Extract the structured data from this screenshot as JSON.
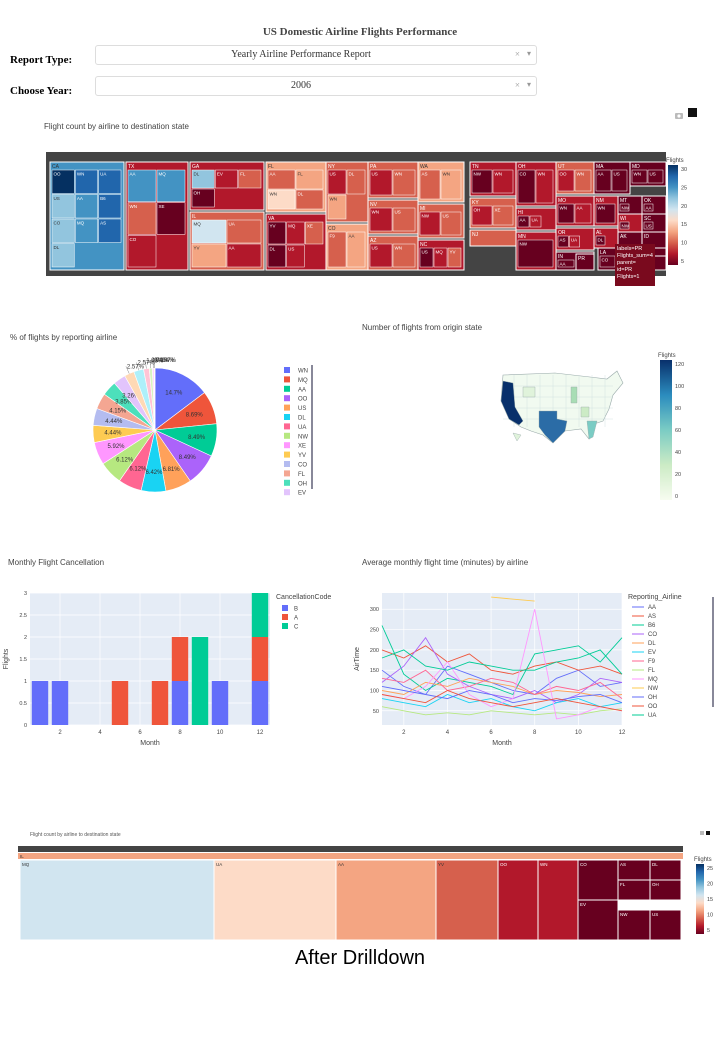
{
  "header": {
    "title": "US Domestic Airline Flights Performance"
  },
  "controls": {
    "report_label": "Report Type:",
    "report_value": "Yearly Airline Performance Report",
    "year_label": "Choose Year:",
    "year_value": "2006",
    "clear_glyph": "×",
    "caret_glyph": "▾"
  },
  "treemap1": {
    "title": "Flight count by airline to destination state",
    "colorbar": {
      "title": "Flights",
      "ticks": [
        "30",
        "25",
        "20",
        "15",
        "10",
        "5"
      ]
    },
    "states": [
      {
        "label": "CA",
        "children": [
          "OO",
          "WN",
          "UA",
          "US",
          "AA",
          "B6",
          "CO",
          "MQ",
          "AS",
          "DL"
        ]
      },
      {
        "label": "TX",
        "children": [
          "AA",
          "MQ",
          "WN",
          "XE",
          "CO"
        ]
      },
      {
        "label": "GA",
        "children": [
          "DL",
          "EV",
          "FL",
          "OH"
        ]
      },
      {
        "label": "IL",
        "children": [
          "MQ",
          "UA",
          "YV",
          "AA"
        ]
      },
      {
        "label": "FL",
        "children": [
          "AA",
          "FL",
          "WN",
          "DL"
        ]
      },
      {
        "label": "VA",
        "children": [
          "YV",
          "MQ",
          "XE",
          "DL",
          "US"
        ]
      },
      {
        "label": "NY",
        "children": [
          "US",
          "DL",
          "WN"
        ]
      },
      {
        "label": "CO",
        "children": [
          "F9",
          "AA"
        ]
      },
      {
        "label": "PA",
        "children": [
          "US",
          "WN"
        ]
      },
      {
        "label": "NV",
        "children": [
          "WN",
          "US"
        ]
      },
      {
        "label": "AZ",
        "children": [
          "US",
          "WN"
        ]
      },
      {
        "label": "WA",
        "children": [
          "AS",
          "WN"
        ]
      },
      {
        "label": "MI",
        "children": [
          "NW",
          "US"
        ]
      },
      {
        "label": "NC",
        "children": [
          "US",
          "MQ",
          "YV"
        ]
      },
      {
        "label": "TN",
        "children": [
          "NW",
          "WN"
        ]
      },
      {
        "label": "KY",
        "children": [
          "OH",
          "XE"
        ]
      },
      {
        "label": "NJ",
        "children": [
          "XE",
          "CO"
        ]
      },
      {
        "label": "OH",
        "children": [
          "CO",
          "WN"
        ]
      },
      {
        "label": "HI",
        "children": [
          "AA",
          "UA"
        ]
      },
      {
        "label": "MN",
        "children": [
          "NW"
        ]
      },
      {
        "label": "UT",
        "children": [
          "OO",
          "WN"
        ]
      },
      {
        "label": "MO",
        "children": [
          "WN",
          "AA"
        ]
      },
      {
        "label": "OR",
        "children": [
          "AS",
          "UA"
        ]
      },
      {
        "label": "IN",
        "children": [
          "AA"
        ]
      },
      {
        "label": "MA",
        "children": [
          "AA",
          "US"
        ]
      },
      {
        "label": "MD",
        "children": [
          "WN",
          "US"
        ]
      },
      {
        "label": "NM",
        "children": [
          "WN"
        ]
      },
      {
        "label": "MT",
        "children": [
          "NW"
        ]
      },
      {
        "label": "OK",
        "children": [
          "AA"
        ]
      },
      {
        "label": "AL",
        "children": [
          "DL"
        ]
      },
      {
        "label": "WI",
        "children": [
          "NW"
        ]
      },
      {
        "label": "SC",
        "children": [
          "US"
        ]
      },
      {
        "label": "AK",
        "children": [
          "AS"
        ]
      },
      {
        "label": "ID",
        "children": [
          "OO"
        ]
      },
      {
        "label": "LA",
        "children": [
          "CO"
        ]
      },
      {
        "label": "RI",
        "children": [
          "US"
        ]
      },
      {
        "label": "CT",
        "children": [
          "US"
        ]
      },
      {
        "label": "NE",
        "children": [
          "UA"
        ]
      },
      {
        "label": "PR",
        "children": []
      }
    ],
    "tooltip": {
      "line1": "labels=PR",
      "line2": "Flights_sum=4",
      "line3": "parent=",
      "line4": "id=PR",
      "line5": "Flights=1"
    }
  },
  "pie": {
    "title": "% of flights by reporting airline",
    "slices": [
      {
        "airline": "WN",
        "pct": 14.7,
        "label": "14.7%",
        "color": "#636efa"
      },
      {
        "airline": "MQ",
        "pct": 8.69,
        "label": "8.69%",
        "color": "#ef553b"
      },
      {
        "airline": "AA",
        "pct": 8.49,
        "label": "8.49%",
        "color": "#00cc96"
      },
      {
        "airline": "OO",
        "pct": 8.49,
        "label": "8.49%",
        "color": "#ab63fa"
      },
      {
        "airline": "US",
        "pct": 6.81,
        "label": "6.81%",
        "color": "#ffa15a"
      },
      {
        "airline": "DL",
        "pct": 6.42,
        "label": "6.42%",
        "color": "#19d3f3"
      },
      {
        "airline": "UA",
        "pct": 6.12,
        "label": "6.12%",
        "color": "#ff6692"
      },
      {
        "airline": "NW",
        "pct": 6.12,
        "label": "6.12%",
        "color": "#b6e880"
      },
      {
        "airline": "XE",
        "pct": 5.92,
        "label": "5.92%",
        "color": "#ff97ff"
      },
      {
        "airline": "YV",
        "pct": 4.44,
        "label": "4.44%",
        "color": "#fecb52"
      },
      {
        "airline": "CO",
        "pct": 4.44,
        "label": "4.44%",
        "color": "#b4bcf0"
      },
      {
        "airline": "FL",
        "pct": 4.15,
        "label": "4.15%",
        "color": "#f4a692"
      },
      {
        "airline": "OH",
        "pct": 3.85,
        "label": "3.85%",
        "color": "#4ce0bb"
      },
      {
        "airline": "EV",
        "pct": 3.26,
        "label": "3.26%",
        "color": "#e2c4fc"
      },
      {
        "airline": "B6",
        "pct": 2.57,
        "label": "2.57%",
        "color": "#ffd9b5"
      },
      {
        "airline": "F9",
        "pct": 2.57,
        "label": "2.57%",
        "color": "#aef0fa"
      },
      {
        "airline": "AS",
        "pct": 1.48,
        "label": "1.48%",
        "color": "#ffc4d5"
      },
      {
        "airline": "HA",
        "pct": 0.79,
        "label": "0.79%",
        "color": "#d8f3c0"
      },
      {
        "airline": "TZ",
        "pct": 0.494,
        "label": "0.494%",
        "color": "#ffd6ff"
      },
      {
        "airline": "DH",
        "pct": 0.197,
        "label": "0.197%",
        "color": "#ffebb9"
      }
    ],
    "legend": [
      "WN",
      "MQ",
      "AA",
      "OO",
      "US",
      "DL",
      "UA",
      "NW",
      "XE",
      "YV",
      "CO",
      "FL",
      "OH",
      "EV"
    ]
  },
  "map": {
    "title": "Number of flights from origin state",
    "colorbar": {
      "title": "Flights",
      "ticks": [
        "120",
        "100",
        "80",
        "60",
        "40",
        "20",
        "0"
      ]
    }
  },
  "chart_data": [
    {
      "type": "bar",
      "title": "Monthly Flight Cancellation",
      "xlabel": "Month",
      "ylabel": "Flights",
      "xlim": [
        0.5,
        12.5
      ],
      "ylim": [
        0,
        3
      ],
      "xticks": [
        "2",
        "4",
        "6",
        "8",
        "10",
        "12"
      ],
      "yticks": [
        "0",
        "0.5",
        "1",
        "1.5",
        "2",
        "2.5",
        "3"
      ],
      "legend_title": "CancellationCode",
      "stacked": true,
      "series": [
        {
          "name": "B",
          "color": "#636efa",
          "points": [
            {
              "x": 1,
              "y": 1
            },
            {
              "x": 2,
              "y": 1
            },
            {
              "x": 8,
              "y": 1
            },
            {
              "x": 10,
              "y": 1
            },
            {
              "x": 12,
              "y": 1
            }
          ]
        },
        {
          "name": "A",
          "color": "#ef553b",
          "points": [
            {
              "x": 5,
              "y": 1
            },
            {
              "x": 7,
              "y": 1
            },
            {
              "x": 8,
              "y": 1
            },
            {
              "x": 12,
              "y": 1
            }
          ]
        },
        {
          "name": "C",
          "color": "#00cc96",
          "points": [
            {
              "x": 9,
              "y": 2
            },
            {
              "x": 12,
              "y": 1
            }
          ]
        }
      ]
    },
    {
      "type": "line",
      "title": "Average monthly flight time (minutes) by airline",
      "xlabel": "Month",
      "ylabel": "AirTime",
      "xlim": [
        1,
        12
      ],
      "ylim": [
        15,
        340
      ],
      "xticks": [
        "2",
        "4",
        "6",
        "8",
        "10",
        "12"
      ],
      "yticks": [
        "50",
        "100",
        "150",
        "200",
        "250",
        "300"
      ],
      "legend_title": "Reporting_Airline",
      "x": [
        1,
        2,
        3,
        4,
        5,
        6,
        7,
        8,
        9,
        10,
        11,
        12
      ],
      "series": [
        {
          "name": "AA",
          "color": "#636efa",
          "values": [
            150,
            110,
            90,
            160,
            140,
            120,
            100,
            90,
            130,
            150,
            110,
            120
          ]
        },
        {
          "name": "AS",
          "color": "#ef553b",
          "values": [
            200,
            180,
            210,
            170,
            190,
            150,
            140,
            160,
            170,
            150,
            160,
            140
          ]
        },
        {
          "name": "B6",
          "color": "#00cc96",
          "values": [
            260,
            140,
            100,
            130,
            120,
            110,
            90,
            190,
            200,
            210,
            170,
            230
          ]
        },
        {
          "name": "CO",
          "color": "#ab63fa",
          "values": [
            120,
            160,
            230,
            140,
            110,
            90,
            80,
            100,
            70,
            90,
            130,
            120
          ]
        },
        {
          "name": "DL",
          "color": "#ffa15a",
          "values": [
            100,
            90,
            120,
            110,
            130,
            120,
            110,
            90,
            100,
            95,
            85,
            90
          ]
        },
        {
          "name": "EV",
          "color": "#19d3f3",
          "values": [
            80,
            70,
            60,
            90,
            70,
            80,
            60,
            50,
            70,
            80,
            60,
            70
          ]
        },
        {
          "name": "F9",
          "color": "#ff6692",
          "values": [
            130,
            120,
            150,
            100,
            110,
            130,
            120,
            90,
            110,
            100,
            120,
            80
          ]
        },
        {
          "name": "FL",
          "color": "#b6e880",
          "values": [
            60,
            50,
            40,
            45,
            40,
            50,
            45,
            40,
            45,
            40,
            50,
            55
          ]
        },
        {
          "name": "MQ",
          "color": "#ff97ff",
          "values": [
            90,
            80,
            110,
            170,
            90,
            60,
            80,
            300,
            30,
            40,
            60,
            50
          ]
        },
        {
          "name": "NW",
          "color": "#fecb52",
          "values": [
            null,
            null,
            null,
            null,
            null,
            330,
            null,
            null,
            null,
            null,
            310,
            null
          ]
        },
        {
          "name": "OH",
          "color": "#636efa",
          "values": [
            110,
            100,
            90,
            80,
            100,
            90,
            70,
            80,
            75,
            85,
            90,
            70
          ]
        },
        {
          "name": "OO",
          "color": "#ef553b",
          "values": [
            90,
            80,
            70,
            100,
            80,
            70,
            60,
            70,
            80,
            70,
            60,
            50
          ]
        },
        {
          "name": "UA",
          "color": "#00cc96",
          "values": [
            180,
            200,
            160,
            150,
            170,
            160,
            150,
            150,
            170,
            180,
            200,
            140
          ]
        }
      ]
    }
  ],
  "treemap2": {
    "title": "Flight count by airline to destination state",
    "parent_label": "IL",
    "colorbar": {
      "title": "Flights",
      "ticks": [
        "25",
        "20",
        "15",
        "10",
        "5"
      ]
    },
    "tiles": [
      "MQ",
      "UA",
      "AA",
      "YV",
      "OO",
      "WN",
      "CO",
      "EV",
      "AS",
      "DL",
      "FL",
      "OH",
      "NW",
      "US"
    ]
  },
  "note": "After Drilldown"
}
